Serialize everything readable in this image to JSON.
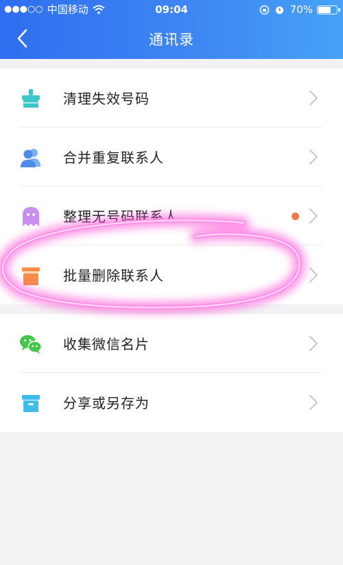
{
  "status_bar": {
    "signal": "●●●○○",
    "carrier": "中国移动",
    "time": "09:04",
    "battery": "70%",
    "battery_level": 0.7
  },
  "nav": {
    "title": "通讯录"
  },
  "menu": [
    {
      "label": "清理失效号码",
      "icon": "broom-icon",
      "icon_color": "#3fc6c8"
    },
    {
      "label": "合并重复联系人",
      "icon": "contacts-icon",
      "icon_color": "#4d8be8"
    },
    {
      "label": "整理无号码联系人",
      "icon": "ghost-icon",
      "icon_color": "#c98ef0",
      "badge": true
    },
    {
      "label": "批量删除联系人",
      "icon": "trash-icon",
      "icon_color": "#f58d49"
    },
    {
      "label": "收集微信名片",
      "icon": "wechat-icon",
      "icon_color": "#43c64a"
    },
    {
      "label": "分享或另存为",
      "icon": "archive-box-icon",
      "icon_color": "#3fbde8"
    }
  ],
  "colors": {
    "header_start": "#2f6ef0",
    "header_end": "#46a2f6",
    "badge": "#f07a47",
    "highlight": "#ff3fd4"
  }
}
